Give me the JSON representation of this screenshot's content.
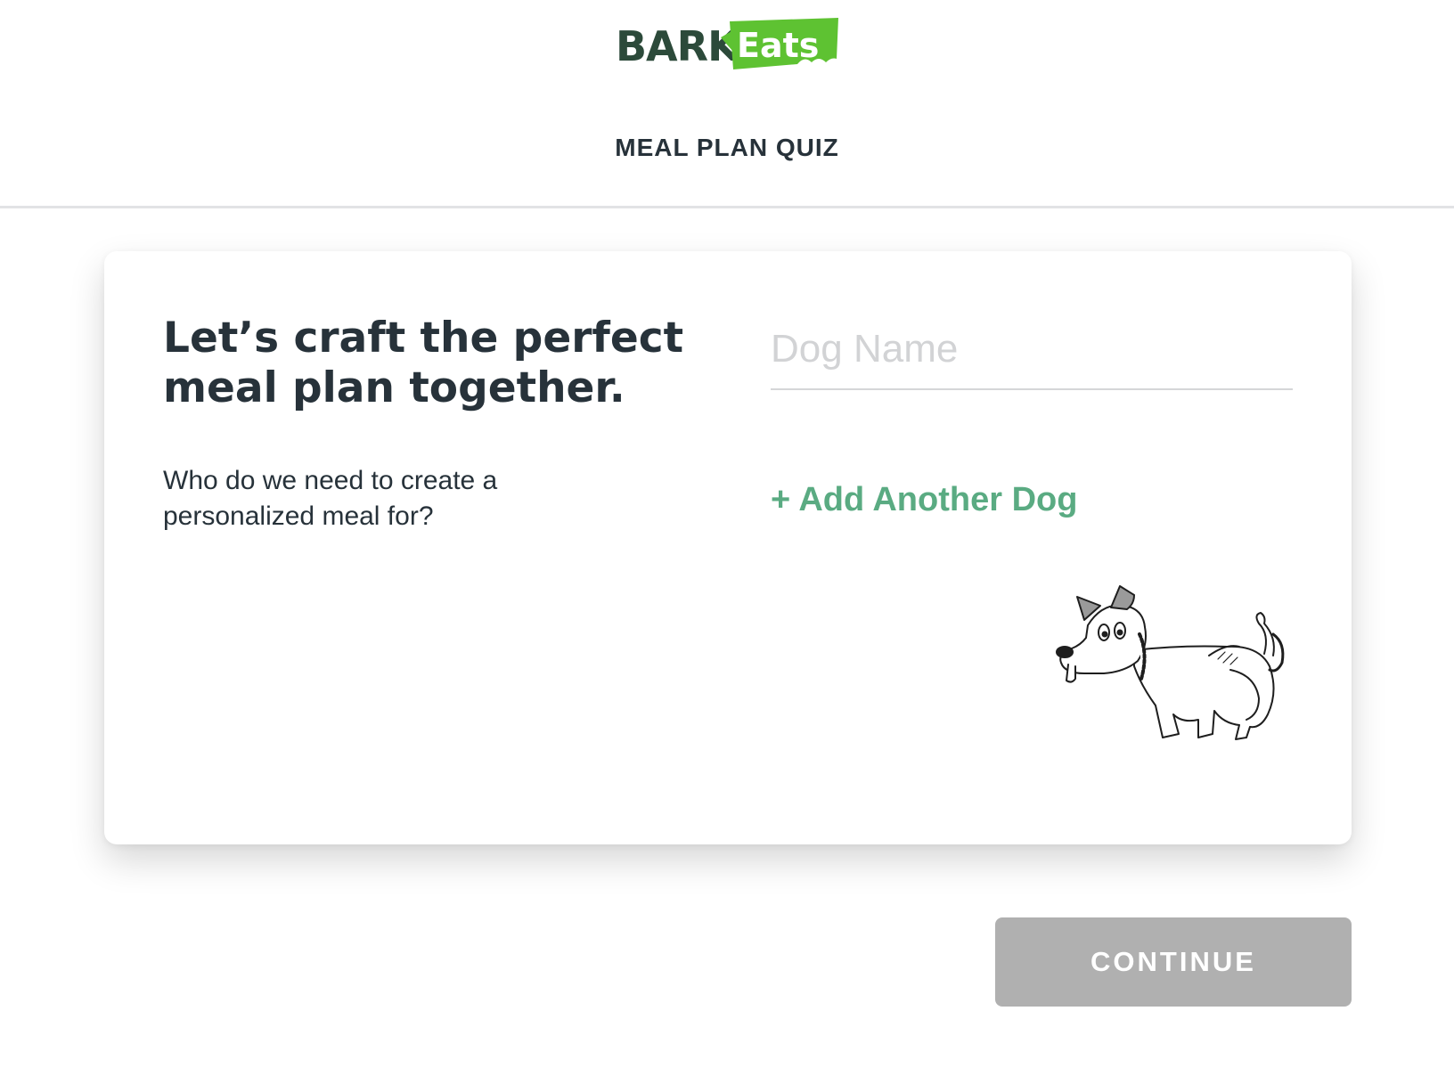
{
  "brand": {
    "logo_part1": "BARK",
    "logo_part2": "Eats",
    "colors": {
      "dark_green": "#2c4a3a",
      "accent_green": "#5ec232"
    }
  },
  "header": {
    "title": "MEAL PLAN QUIZ"
  },
  "card": {
    "headline": "Let’s craft the perfect meal plan together.",
    "subtext": "Who do we need to create a personalized meal for?",
    "dog_name_input": {
      "value": "",
      "placeholder": "Dog Name"
    },
    "add_dog_label": "+ Add Another Dog",
    "illustration": "dog-sketch-icon"
  },
  "footer": {
    "continue_label": "CONTINUE",
    "continue_color": "#b0b0b0"
  },
  "colors": {
    "text": "#27323a",
    "link": "#5aab82"
  }
}
